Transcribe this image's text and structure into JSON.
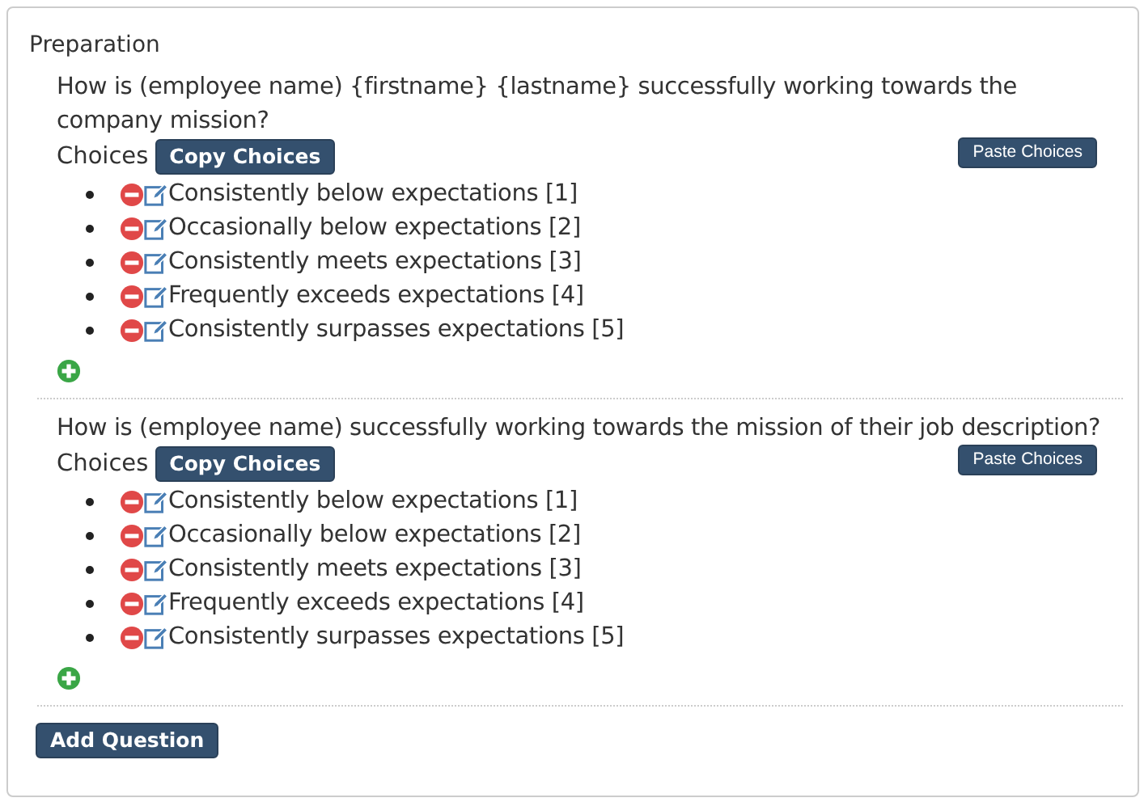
{
  "panel": {
    "title": "Preparation"
  },
  "questions": [
    {
      "text": "How is (employee name) {firstname} {lastname} successfully working towards the company mission?",
      "choices_label": "Choices",
      "copy_button": "Copy Choices",
      "paste_button": "Paste Choices",
      "choices": [
        "Consistently below expectations [1]",
        "Occasionally below expectations [2]",
        "Consistently meets expectations [3]",
        "Frequently exceeds expectations [4]",
        "Consistently surpasses expectations [5]"
      ]
    },
    {
      "text": "How is (employee name) successfully working towards the mission of their job description?",
      "choices_label": "Choices",
      "copy_button": "Copy Choices",
      "paste_button": "Paste Choices",
      "choices": [
        "Consistently below expectations [1]",
        "Occasionally below expectations [2]",
        "Consistently meets expectations [3]",
        "Frequently exceeds expectations [4]",
        "Consistently surpasses expectations [5]"
      ]
    }
  ],
  "add_button": "Add Question"
}
